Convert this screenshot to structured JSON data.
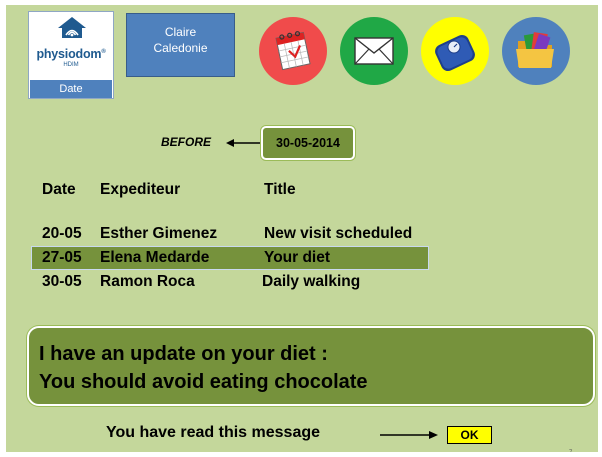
{
  "header": {
    "logo": {
      "brand": "physiodom",
      "registered": "®",
      "sub": "HDIM"
    },
    "date_button": "Date",
    "user": {
      "first_name": "Claire",
      "last_name": "Caledonie"
    },
    "buttons": [
      {
        "icon": "calendar-icon",
        "color": "#f04b4b"
      },
      {
        "icon": "mail-icon",
        "color": "#20a846"
      },
      {
        "icon": "scale-icon",
        "color": "#ffff00"
      },
      {
        "icon": "folder-icon",
        "color": "#4f81bd"
      }
    ]
  },
  "filter": {
    "label": "BEFORE",
    "date": "30-05-2014"
  },
  "messages": {
    "columns": [
      "Date",
      "Expediteur",
      "Title"
    ],
    "rows": [
      {
        "date": "20-05",
        "sender": "Esther Gimenez",
        "title": "New visit scheduled",
        "selected": false
      },
      {
        "date": "27-05",
        "sender": "Elena Medarde",
        "title": "Your diet",
        "selected": true
      },
      {
        "date": "30-05",
        "sender": "Ramon Roca",
        "title": "Daily walking",
        "selected": false
      }
    ]
  },
  "message_body": {
    "line1": "I have an update on your diet :",
    "line2": "You should avoid eating chocolate"
  },
  "footer": {
    "read_label": "You have read this message",
    "ok_label": "OK"
  },
  "page_number": "7",
  "colors": {
    "background": "#c4d79b",
    "accent": "#76923c",
    "blue": "#4f81bd",
    "ok": "#ffff00"
  }
}
